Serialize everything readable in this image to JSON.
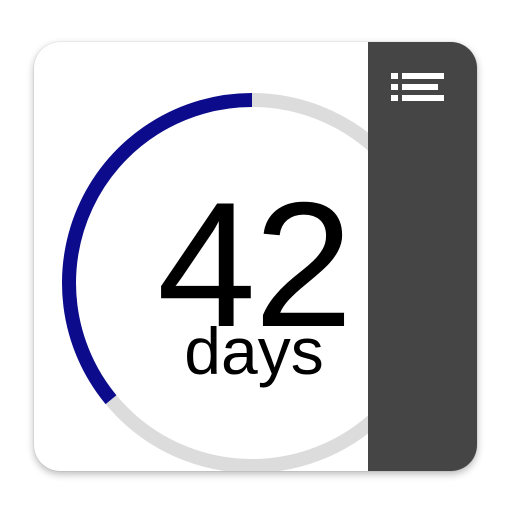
{
  "countdown": {
    "value": "42",
    "unit": "days",
    "progress_fraction": 0.36
  },
  "colors": {
    "progress_arc": "#0b0b8c",
    "track_arc": "#dcdcdc",
    "side_panel": "#454545",
    "menu_icon": "#ffffff"
  },
  "side_panel": {
    "menu_icon_name": "list-menu-icon"
  }
}
